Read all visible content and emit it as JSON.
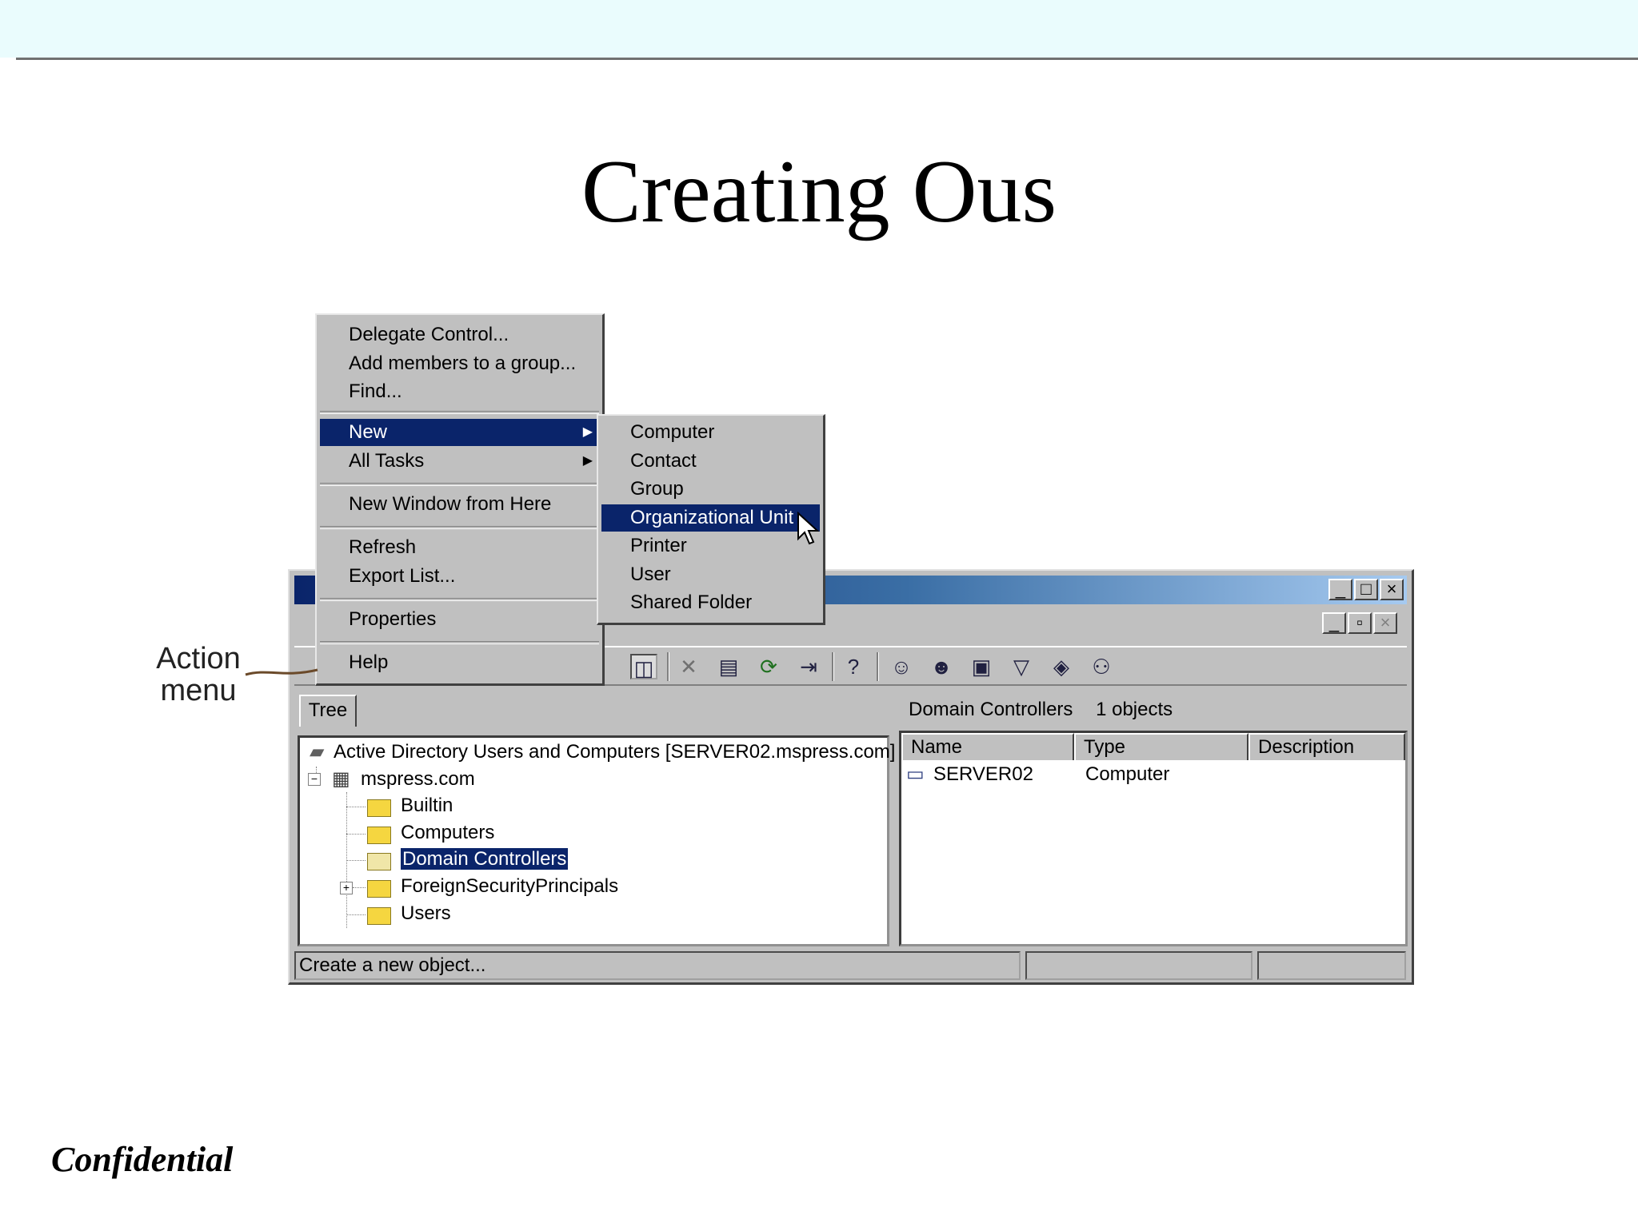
{
  "slide": {
    "title": "Creating Ous",
    "footer": "Confidential",
    "callout": "Action menu"
  },
  "action_menu": {
    "items": [
      {
        "label": "Delegate Control..."
      },
      {
        "label": "Add members to a group..."
      },
      {
        "label": "Find..."
      },
      {
        "label": "New",
        "highlighted": true,
        "submenu": true
      },
      {
        "label": "All Tasks",
        "submenu": true
      },
      {
        "label": "New Window from Here"
      },
      {
        "label": "Refresh"
      },
      {
        "label": "Export List..."
      },
      {
        "label": "Properties"
      },
      {
        "label": "Help"
      }
    ]
  },
  "new_submenu": {
    "items": [
      {
        "label": "Computer"
      },
      {
        "label": "Contact"
      },
      {
        "label": "Group"
      },
      {
        "label": "Organizational Unit",
        "highlighted": true
      },
      {
        "label": "Printer"
      },
      {
        "label": "User"
      },
      {
        "label": "Shared Folder"
      }
    ]
  },
  "window": {
    "tree_tab": "Tree",
    "tree": {
      "root": "Active Directory Users and Computers [SERVER02.mspress.com]",
      "domain": "mspress.com",
      "children": [
        "Builtin",
        "Computers",
        "Domain Controllers",
        "ForeignSecurityPrincipals",
        "Users"
      ],
      "selected": "Domain Controllers"
    },
    "right_header": {
      "folder": "Domain Controllers",
      "count": "1 objects"
    },
    "columns": [
      "Name",
      "Type",
      "Description"
    ],
    "rows": [
      {
        "name": "SERVER02",
        "type": "Computer",
        "description": ""
      }
    ],
    "status": "Create a new object..."
  },
  "colors": {
    "highlight": "#0a246a",
    "face": "#c0c0c0",
    "band": "#eafcfd"
  }
}
